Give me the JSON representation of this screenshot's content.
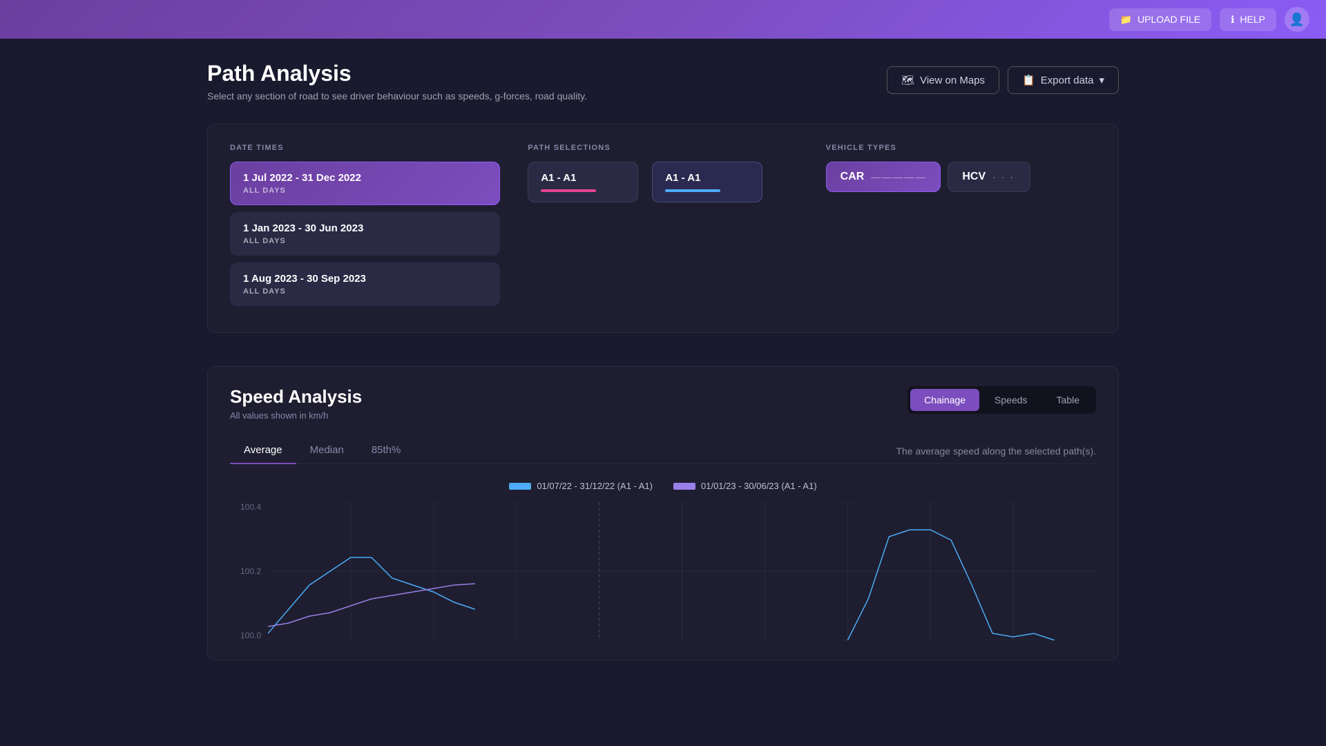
{
  "header": {
    "upload_label": "UPLOAD FILE",
    "help_label": "HELP",
    "upload_icon": "📁",
    "help_icon": "ℹ"
  },
  "page": {
    "title": "Path Analysis",
    "subtitle": "Select any section of road to see driver behaviour such as speeds, g-forces, road quality.",
    "view_maps_label": "View on Maps",
    "export_label": "Export data"
  },
  "filters": {
    "date_times_label": "DATE TIMES",
    "path_selections_label": "PATH SELECTIONS",
    "vehicle_types_label": "VEHICLE TYPES",
    "date_cards": [
      {
        "title": "1 Jul 2022 - 31 Dec 2022",
        "sub": "ALL DAYS",
        "active": true
      },
      {
        "title": "1 Jan 2023 - 30 Jun 2023",
        "sub": "ALL DAYS",
        "active": false
      },
      {
        "title": "1 Aug 2023 - 30 Sep 2023",
        "sub": "ALL DAYS",
        "active": false
      }
    ],
    "path_cards": [
      {
        "title": "A1 - A1",
        "bar_color": "pink",
        "active": false
      },
      {
        "title": "A1 - A1",
        "bar_color": "blue",
        "active": true
      }
    ],
    "vehicle_cards": [
      {
        "label": "CAR",
        "active": true,
        "dashes": "—————"
      },
      {
        "label": "HCV",
        "active": false,
        "dashes": "· · ·"
      }
    ]
  },
  "speed_analysis": {
    "title": "Speed Analysis",
    "subtitle": "All values shown in km/h",
    "view_tabs": [
      {
        "label": "Chainage",
        "active": true
      },
      {
        "label": "Speeds",
        "active": false
      },
      {
        "label": "Table",
        "active": false
      }
    ],
    "sub_tabs": [
      {
        "label": "Average",
        "active": true
      },
      {
        "label": "Median",
        "active": false
      },
      {
        "label": "85th%",
        "active": false
      }
    ],
    "description": "The average speed along the selected path(s).",
    "legend": [
      {
        "label": "01/07/22 - 31/12/22 (A1 - A1)",
        "color": "blue"
      },
      {
        "label": "01/01/23 - 30/06/23 (A1 - A1)",
        "color": "purple"
      }
    ],
    "chart": {
      "y_labels": [
        "100.4",
        "100.2",
        "100.0"
      ],
      "x_labels": []
    }
  }
}
